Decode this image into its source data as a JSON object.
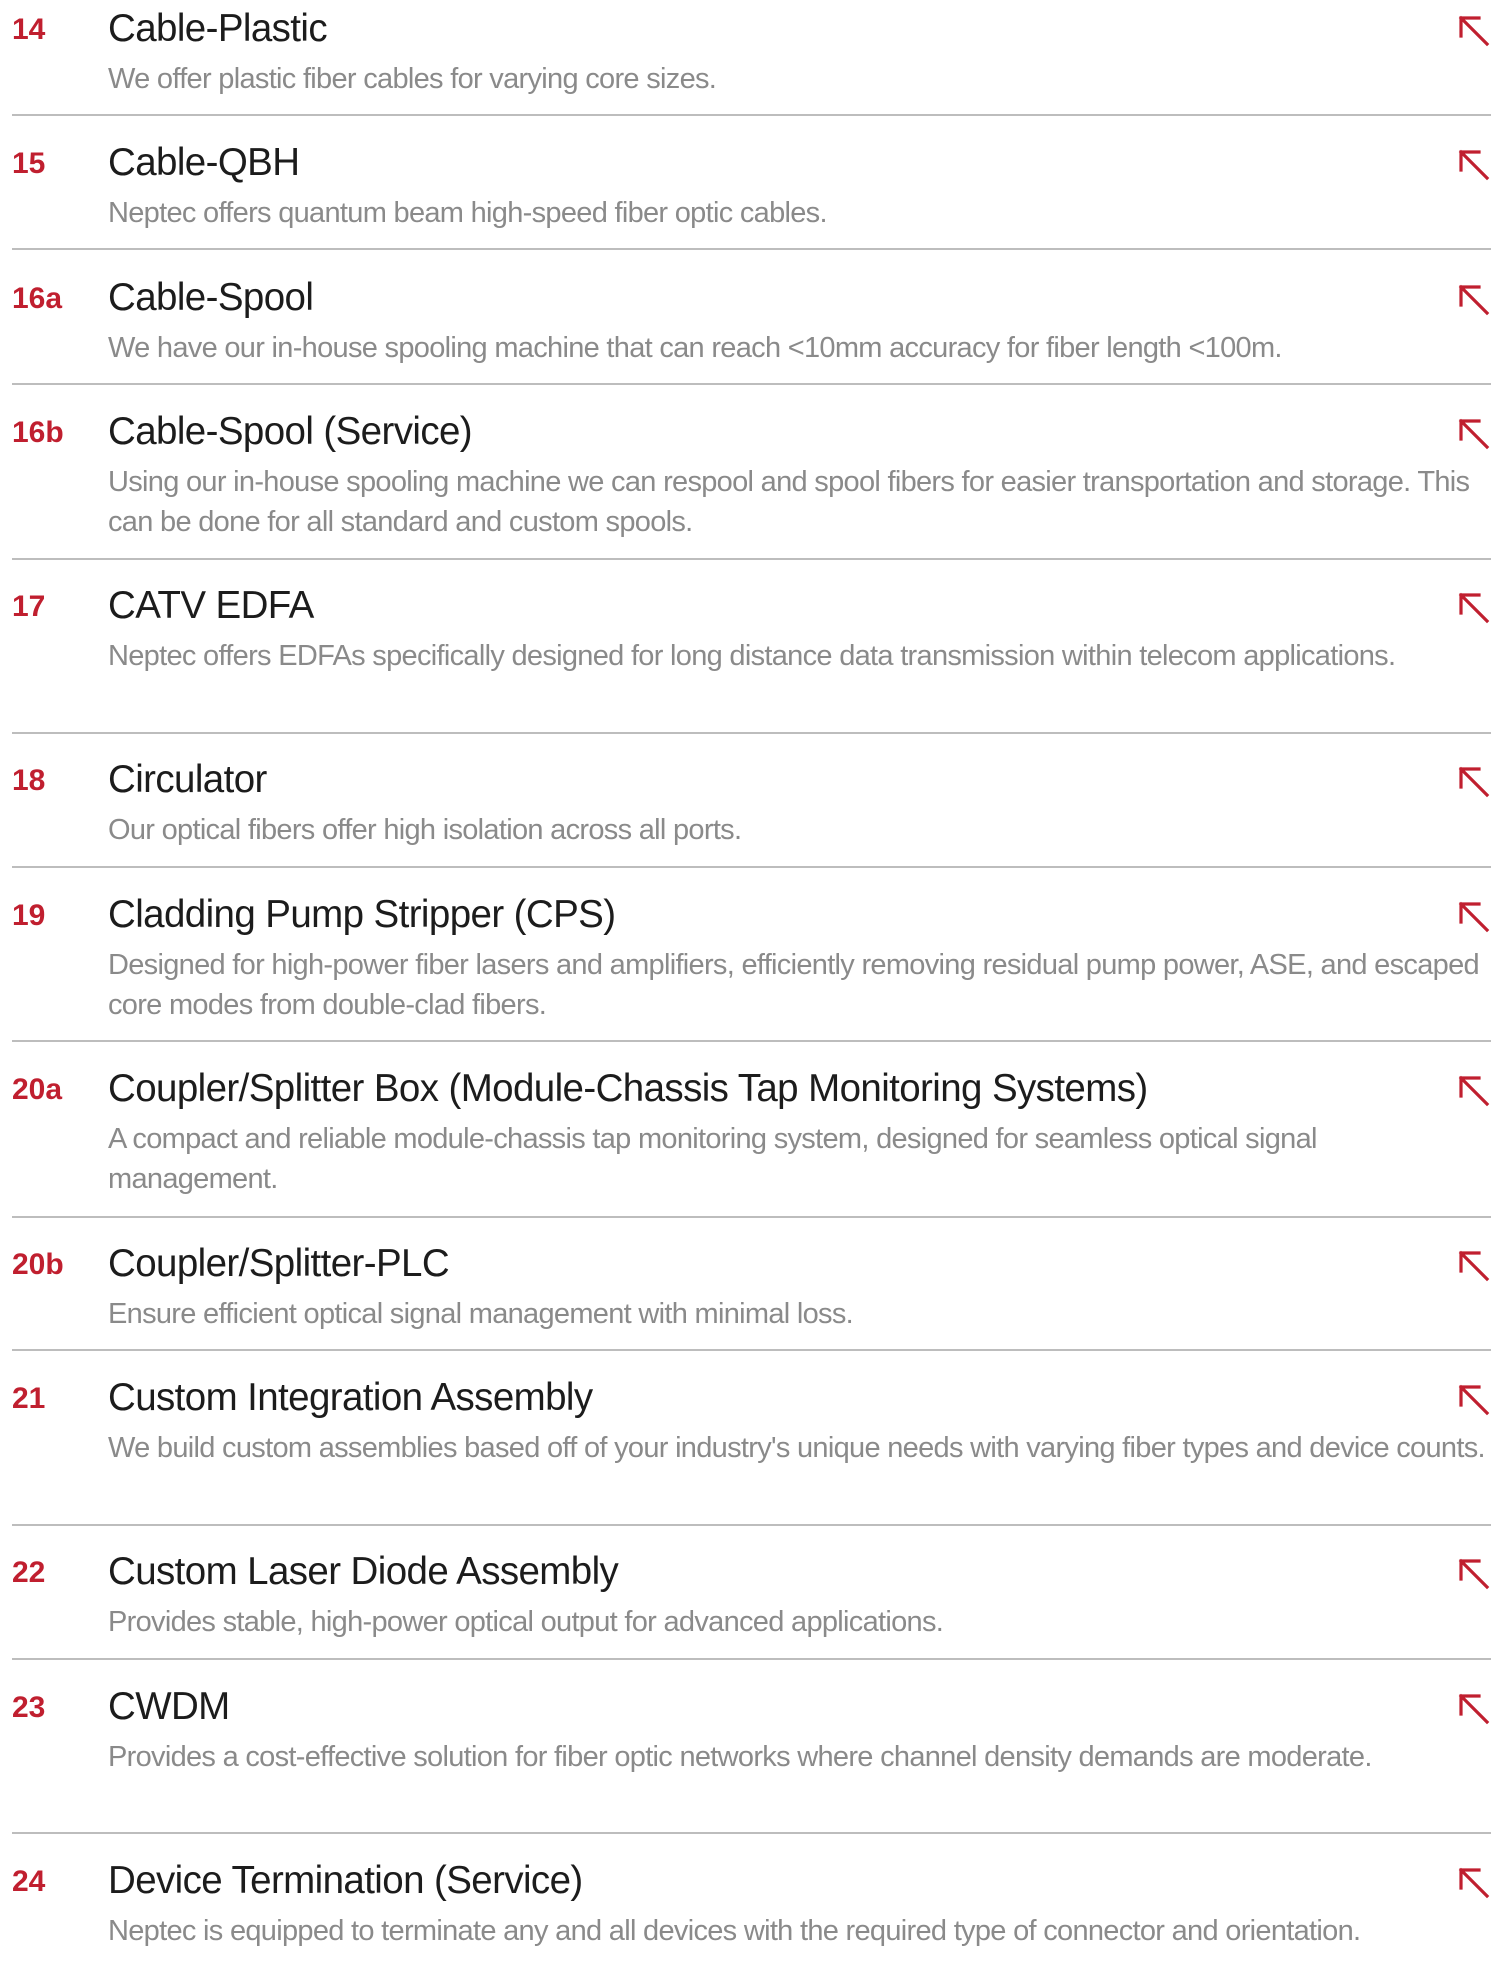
{
  "accent_color": "#c01f2f",
  "arrow_icon": "arrow-up-left-icon",
  "items": [
    {
      "number": "14",
      "title": "Cable-Plastic",
      "description": "We offer plastic fiber cables for varying core sizes."
    },
    {
      "number": "15",
      "title": "Cable-QBH",
      "description": "Neptec offers quantum beam high-speed fiber optic cables."
    },
    {
      "number": "16a",
      "title": "Cable-Spool",
      "description": "We have our in-house spooling machine that can reach <10mm accuracy for fiber length <100m."
    },
    {
      "number": "16b",
      "title": "Cable-Spool (Service)",
      "description": "Using our in-house spooling machine we can respool and spool fibers for easier transportation and storage. This can be done for all standard and custom spools."
    },
    {
      "number": "17",
      "title": "CATV EDFA",
      "description": "Neptec offers EDFAs specifically designed for long distance data transmission within telecom applications."
    },
    {
      "number": "18",
      "title": "Circulator",
      "description": "Our optical fibers offer high isolation across all ports."
    },
    {
      "number": "19",
      "title": "Cladding Pump Stripper (CPS)",
      "description": "Designed for high-power fiber lasers and amplifiers, efficiently removing residual pump power, ASE, and escaped core modes from double-clad fibers."
    },
    {
      "number": "20a",
      "title": "Coupler/Splitter Box (Module-Chassis Tap Monitoring Systems)",
      "description": "A compact and reliable module-chassis tap monitoring system, designed for seamless optical signal management."
    },
    {
      "number": "20b",
      "title": "Coupler/Splitter-PLC",
      "description": "Ensure efficient optical signal management with minimal loss."
    },
    {
      "number": "21",
      "title": "Custom Integration Assembly",
      "description": "We build custom assemblies based off of your industry's unique needs with varying fiber types and device counts."
    },
    {
      "number": "22",
      "title": "Custom Laser Diode Assembly",
      "description": "Provides stable, high-power optical output for advanced applications."
    },
    {
      "number": "23",
      "title": "CWDM",
      "description": "Provides a cost-effective solution for fiber optic networks where channel density demands are moderate."
    },
    {
      "number": "24",
      "title": "Device Termination (Service)",
      "description": "Neptec is equipped to terminate any and all devices with the required type of connector and orientation."
    }
  ]
}
